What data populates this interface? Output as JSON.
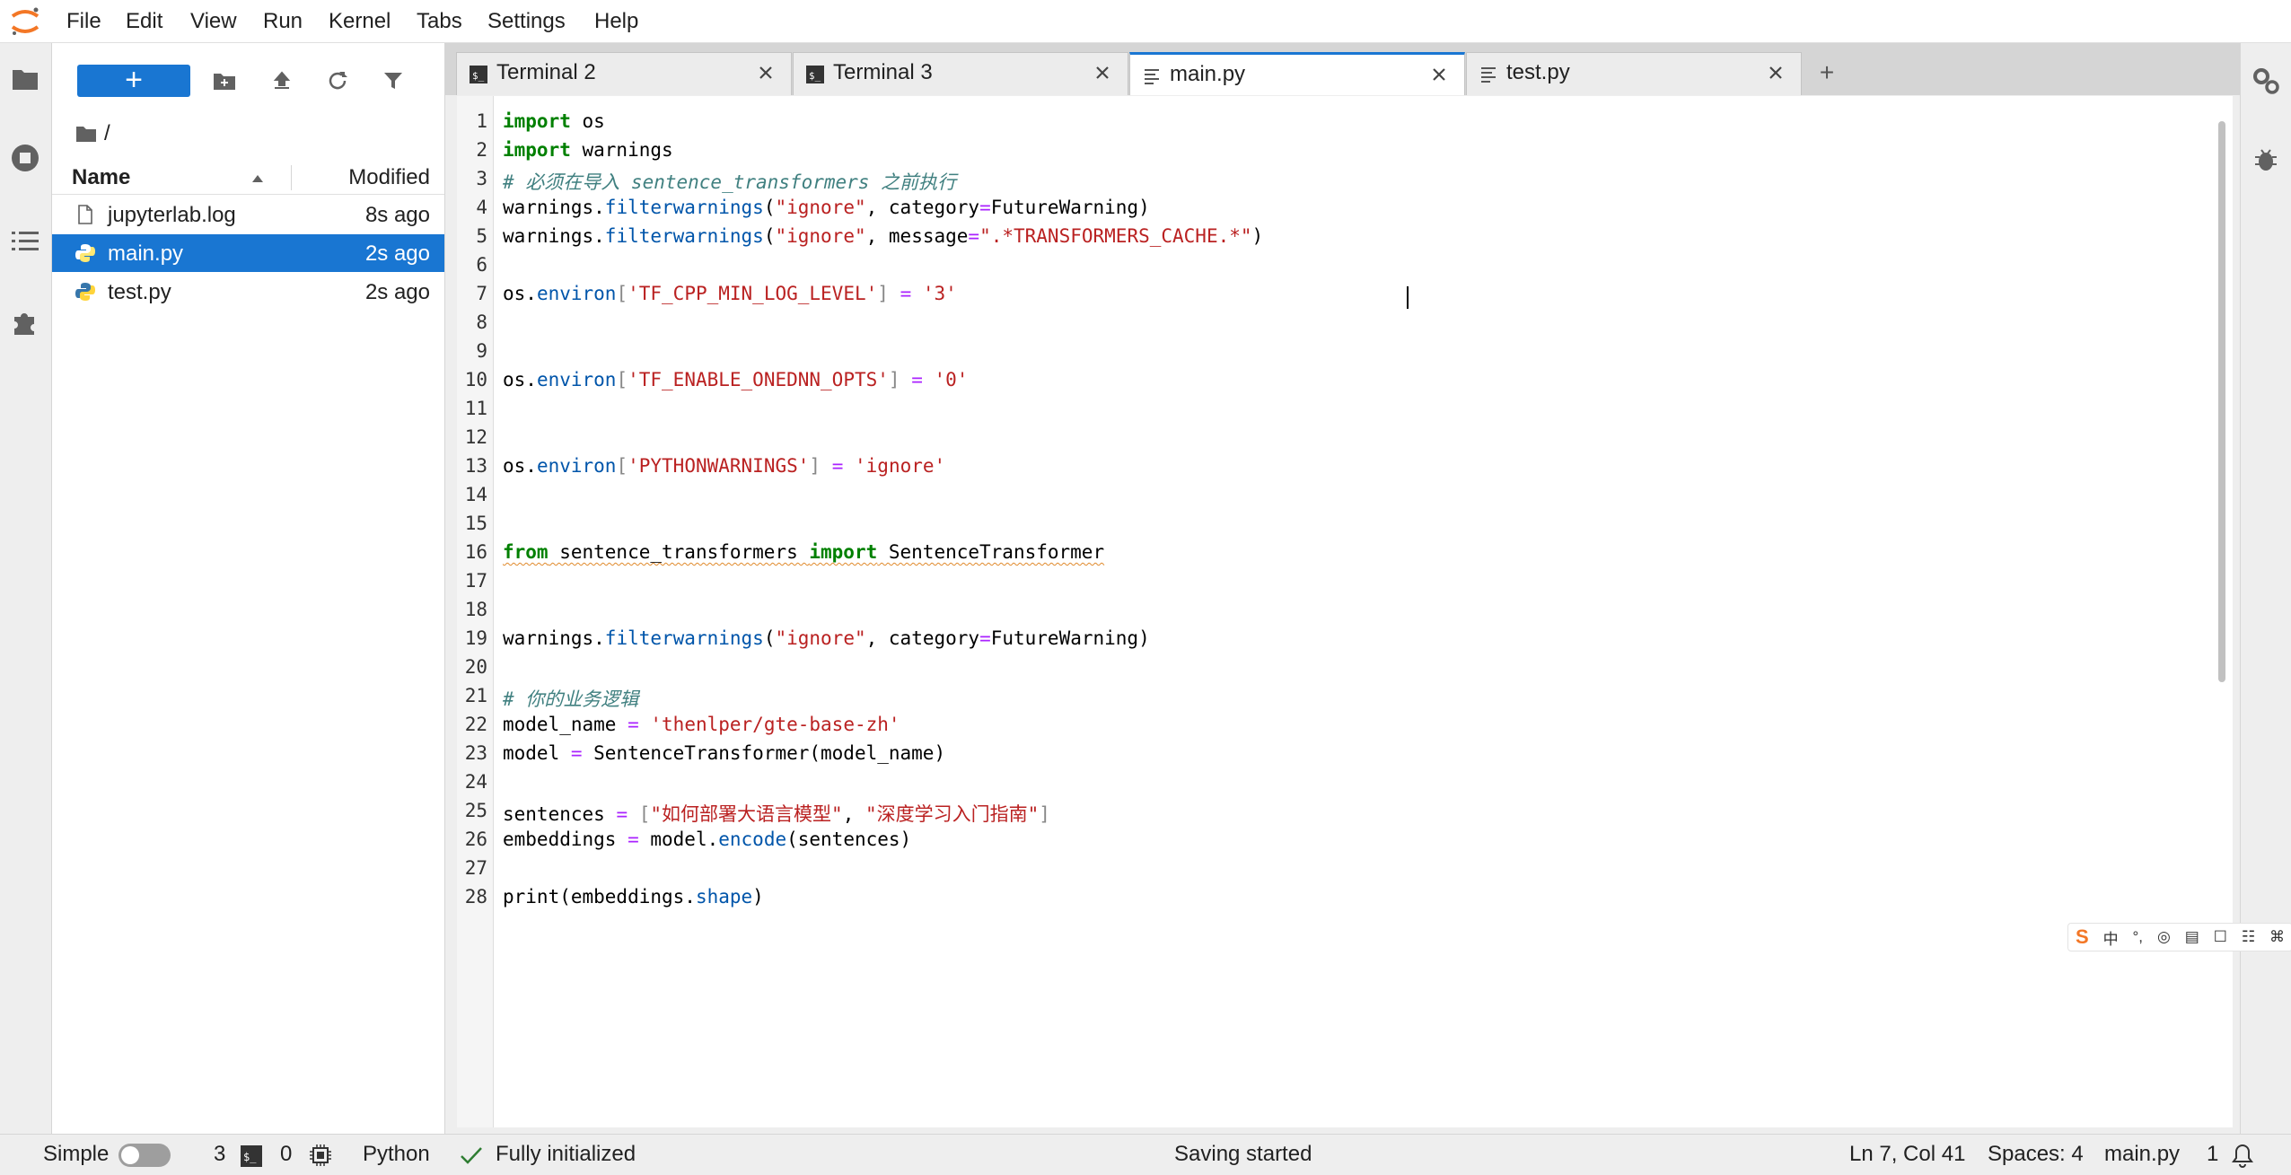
{
  "menu": [
    "File",
    "Edit",
    "View",
    "Run",
    "Kernel",
    "Tabs",
    "Settings",
    "Help"
  ],
  "filebrowser": {
    "new_label": "+",
    "breadcrumb": "/",
    "columns": {
      "name": "Name",
      "modified": "Modified"
    },
    "files": [
      {
        "name": "jupyterlab.log",
        "modified": "8s ago",
        "icon": "file-icon"
      },
      {
        "name": "main.py",
        "modified": "2s ago",
        "icon": "python-icon",
        "selected": true
      },
      {
        "name": "test.py",
        "modified": "2s ago",
        "icon": "python-icon"
      }
    ]
  },
  "tabs": [
    {
      "label": "Terminal 2",
      "icon": "terminal-icon"
    },
    {
      "label": "Terminal 3",
      "icon": "terminal-icon"
    },
    {
      "label": "main.py",
      "icon": "text-file-icon",
      "active": true
    },
    {
      "label": "test.py",
      "icon": "text-file-icon"
    }
  ],
  "add_tab_label": "+",
  "editor": {
    "line_numbers": [
      "1",
      "2",
      "3",
      "4",
      "5",
      "6",
      "7",
      "8",
      "9",
      "10",
      "11",
      "12",
      "13",
      "14",
      "15",
      "16",
      "17",
      "18",
      "19",
      "20",
      "21",
      "22",
      "23",
      "24",
      "25",
      "26",
      "27",
      "28"
    ],
    "code": {
      "l1": {
        "kw": "import",
        "rest": " os"
      },
      "l2": {
        "kw": "import",
        "rest": " warnings"
      },
      "l3": "# 必须在导入 sentence_transformers 之前执行",
      "l4": {
        "a": "warnings.",
        "b": "filterwarnings",
        "c": "(",
        "d": "\"ignore\"",
        "e": ", category",
        "f": "=",
        "g": "FutureWarning)"
      },
      "l5": {
        "a": "warnings.",
        "b": "filterwarnings",
        "c": "(",
        "d": "\"ignore\"",
        "e": ", message",
        "f": "=",
        "g": "\".*TRANSFORMERS_CACHE.*\"",
        "h": ")"
      },
      "l7": {
        "a": "os.",
        "b": "environ",
        "c": "[",
        "d": "'TF_CPP_MIN_LOG_LEVEL'",
        "e": "] ",
        "f": "=",
        "g": " ",
        "h": "'3'"
      },
      "l10": {
        "a": "os.",
        "b": "environ",
        "c": "[",
        "d": "'TF_ENABLE_ONEDNN_OPTS'",
        "e": "] ",
        "f": "=",
        "g": " ",
        "h": "'0'"
      },
      "l13": {
        "a": "os.",
        "b": "environ",
        "c": "[",
        "d": "'PYTHONWARNINGS'",
        "e": "] ",
        "f": "=",
        "g": " ",
        "h": "'ignore'"
      },
      "l16": {
        "kw1": "from",
        "a": " sentence_transformers ",
        "kw2": "import",
        "b": " SentenceTransformer"
      },
      "l19": {
        "a": "warnings.",
        "b": "filterwarnings",
        "c": "(",
        "d": "\"ignore\"",
        "e": ", category",
        "f": "=",
        "g": "FutureWarning)"
      },
      "l21": "# 你的业务逻辑",
      "l22": {
        "a": "model_name ",
        "f": "=",
        "g": " ",
        "h": "'thenlper/gte-base-zh'"
      },
      "l23": {
        "a": "model ",
        "f": "=",
        "g": " SentenceTransformer(model_name)"
      },
      "l25": {
        "a": "sentences ",
        "f": "=",
        "g": " ",
        "c": "[",
        "d": "\"如何部署大语言模型\"",
        "e": ", ",
        "h": "\"深度学习入门指南\"",
        "i": "]"
      },
      "l26": {
        "a": "embeddings ",
        "f": "=",
        "g": " model.",
        "b": "encode",
        "h": "(sentences)"
      },
      "l28": {
        "a": "print",
        "b": "(embeddings.",
        "c": "shape",
        "d": ")"
      }
    }
  },
  "ime": [
    "中",
    "°,",
    "◎",
    "▤",
    "☐",
    "☷",
    "⌘"
  ],
  "status": {
    "mode": "Simple",
    "terminals": "3",
    "kernels": "0",
    "kernel_name": "Python",
    "kernel_state": "Fully initialized",
    "message": "Saving started",
    "position": "Ln 7, Col 41",
    "spaces": "Spaces: 4",
    "file": "main.py",
    "notifications": "1"
  },
  "colors": {
    "accent": "#1976d2",
    "keyword": "#008000",
    "string": "#ba2121",
    "comment": "#408080",
    "property": "#0055aa",
    "operator": "#aa22ff"
  }
}
